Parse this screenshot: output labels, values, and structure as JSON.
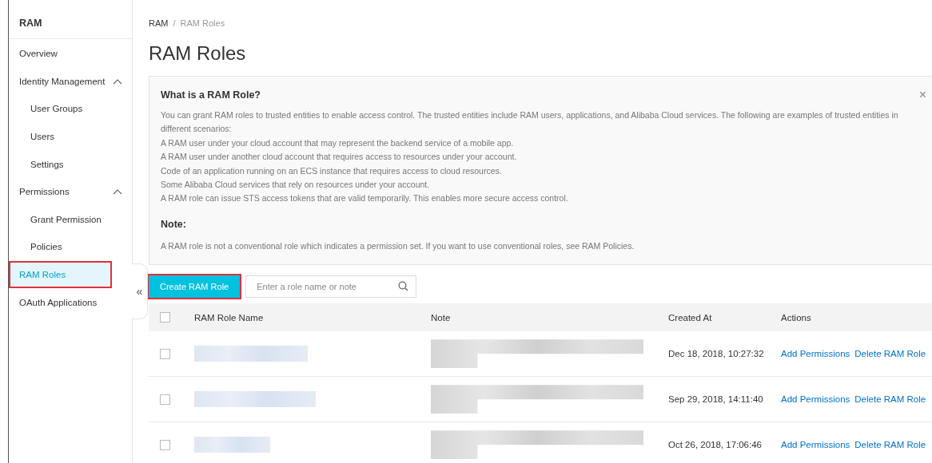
{
  "sidebar": {
    "title": "RAM",
    "items": [
      {
        "label": "Overview",
        "selected": false,
        "highlighted": false
      },
      {
        "label": "Identity Management",
        "selected": false,
        "highlighted": false,
        "expanded": true,
        "children": [
          {
            "label": "User Groups",
            "selected": false,
            "highlighted": false
          },
          {
            "label": "Users",
            "selected": false,
            "highlighted": false
          },
          {
            "label": "Settings",
            "selected": false,
            "highlighted": false
          }
        ]
      },
      {
        "label": "Permissions",
        "selected": false,
        "highlighted": false,
        "expanded": true,
        "children": [
          {
            "label": "Grant Permission",
            "selected": false,
            "highlighted": false
          },
          {
            "label": "Policies",
            "selected": false,
            "highlighted": false
          }
        ]
      },
      {
        "label": "RAM Roles",
        "selected": true,
        "highlighted": true
      },
      {
        "label": "OAuth Applications",
        "selected": false,
        "highlighted": false
      }
    ],
    "collapse": "«"
  },
  "breadcrumb": [
    "RAM",
    "RAM Roles"
  ],
  "breadcrumb_separator": "/",
  "title": "RAM Roles",
  "info": {
    "heading": "What is a RAM Role?",
    "paragraphs": [
      "You can grant RAM roles to trusted entities to enable access control. The trusted entities include RAM users, applications, and Alibaba Cloud services. The following are examples of trusted entities in different scenarios:",
      "A RAM user under your cloud account that may represent the backend service of a mobile app.",
      "A RAM user under another cloud account that requires access to resources under your account.",
      "Code of an application running on an ECS instance that requires access to cloud resources.",
      "Some Alibaba Cloud services that rely on resources under your account.",
      "A RAM role can issue STS access tokens that are valid temporarily. This enables more secure access control."
    ],
    "note_heading": "Note:",
    "note": "A RAM role is not a conventional role which indicates a permission set. If you want to use conventional roles, see RAM Policies.",
    "close": "×"
  },
  "create_button": {
    "label": "Create RAM Role",
    "highlighted": true
  },
  "search": {
    "placeholder": "Enter a role name or note"
  },
  "table": {
    "columns": [
      "RAM Role Name",
      "Note",
      "Created At",
      "Actions"
    ],
    "all_checked": false,
    "rows": [
      {
        "checked": false,
        "redacted": true,
        "created": "Dec 18, 2018, 10:27:32",
        "actions": [
          "Add Permissions",
          "Delete RAM Role"
        ]
      },
      {
        "checked": false,
        "redacted": true,
        "created": "Sep 29, 2018, 14:11:40",
        "actions": [
          "Add Permissions",
          "Delete RAM Role"
        ]
      },
      {
        "checked": false,
        "redacted": true,
        "created": "Oct 26, 2018, 17:06:46",
        "actions": [
          "Add Permissions",
          "Delete RAM Role"
        ]
      }
    ]
  }
}
